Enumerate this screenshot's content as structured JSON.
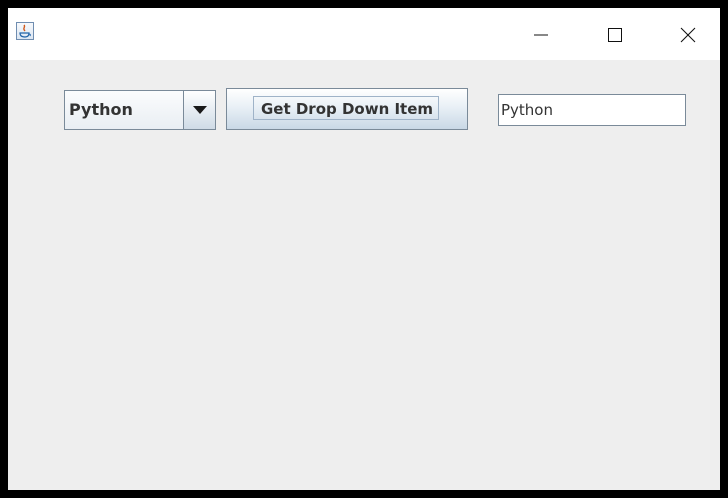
{
  "window": {
    "app_icon": "java-icon",
    "controls": {
      "minimize_icon": "minimize-icon",
      "maximize_icon": "maximize-icon",
      "close_icon": "close-icon"
    }
  },
  "form": {
    "combo": {
      "selected": "Python",
      "arrow_icon": "caret-down-icon"
    },
    "button": {
      "label": "Get Drop Down Item"
    },
    "text_field": {
      "value": "Python"
    }
  }
}
